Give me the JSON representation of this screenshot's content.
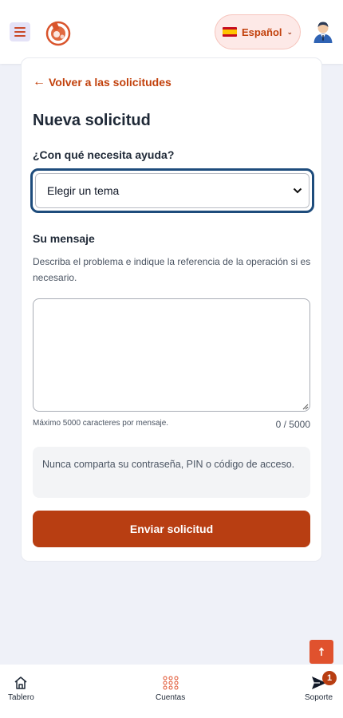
{
  "header": {
    "language": {
      "label": "Español",
      "flag": "spain-flag-icon"
    }
  },
  "form": {
    "back_link": "Volver a las solicitudes",
    "title": "Nueva solicitud",
    "topic_label": "¿Con qué necesita ayuda?",
    "topic_select": {
      "selected": "Elegir un tema"
    },
    "message_label": "Su mensaje",
    "message_help": "Describa el problema e indique la referencia de la operación si es necesario.",
    "message_value": "",
    "max_chars_note": "Máximo 5000 caracteres por mensaje.",
    "char_counter": "0 / 5000",
    "security_notice": "Nunca comparta su contraseña, PIN o código de acceso.",
    "submit_label": "Enviar solicitud"
  },
  "bottom_nav": {
    "items": [
      {
        "label": "Tablero",
        "icon": "home-icon"
      },
      {
        "label": "Cuentas",
        "icon": "grid-dots-icon"
      },
      {
        "label": "Soporte",
        "icon": "send-icon",
        "badge": "1"
      }
    ]
  },
  "colors": {
    "accent": "#b83e12",
    "link": "#c2410c",
    "focus_ring": "#1e4c7c",
    "background": "#eff1f8"
  }
}
